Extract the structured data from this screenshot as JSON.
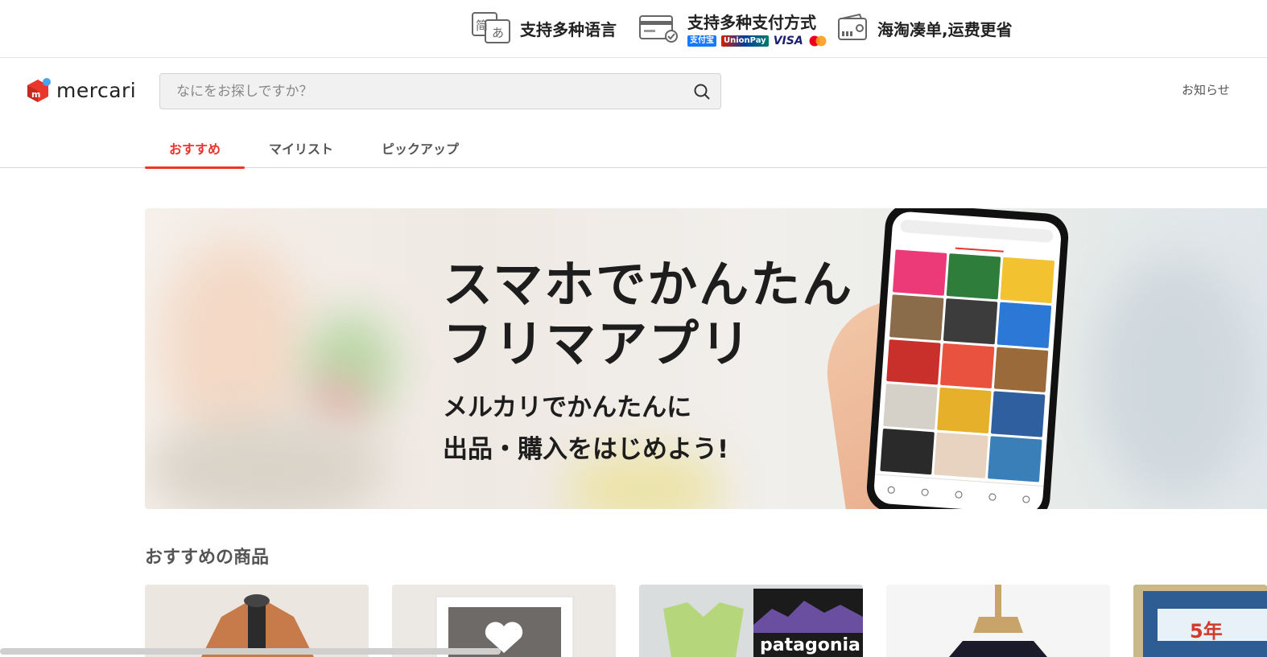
{
  "promo": {
    "language": "支持多种语言",
    "payment": "支持多种支付方式",
    "shipping": "海淘凑单,运费更省",
    "payment_badges": {
      "alipay": "支付宝",
      "unionpay": "UnionPay",
      "visa": "VISA"
    },
    "lang_icon_chars": {
      "left": "简",
      "right": "あ"
    }
  },
  "header": {
    "logo_text": "mercari",
    "search_placeholder": "なにをお探しですか？",
    "notice": "お知らせ"
  },
  "tabs": [
    {
      "label": "おすすめ",
      "active": true
    },
    {
      "label": "マイリスト",
      "active": false
    },
    {
      "label": "ピックアップ",
      "active": false
    }
  ],
  "hero": {
    "title": "スマホでかんたん\nフリマアプリ",
    "subtitle": "メルカリでかんたんに\n出品・購入をはじめよう!"
  },
  "section": {
    "title": "おすすめの商品"
  },
  "products": [
    {
      "label": ""
    },
    {
      "label": ""
    },
    {
      "label": "patagonia"
    },
    {
      "label": ""
    },
    {
      "label": "5年"
    }
  ],
  "colors": {
    "accent": "#ea352d",
    "logo_red": "#e9372b",
    "logo_blue": "#45a5f0"
  }
}
